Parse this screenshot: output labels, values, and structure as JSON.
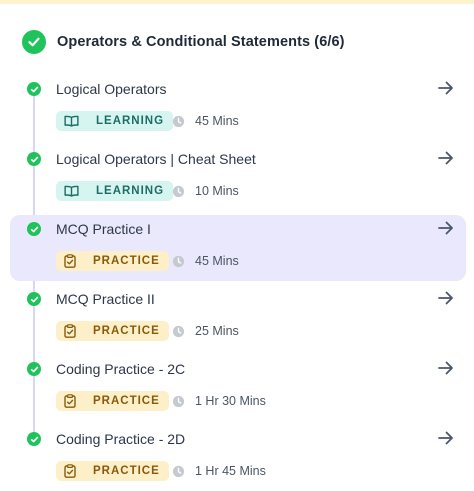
{
  "section": {
    "title": "Operators & Conditional Statements (6/6)"
  },
  "items": [
    {
      "title": "Logical Operators",
      "type": "LEARNING",
      "duration": "45 Mins",
      "active": false
    },
    {
      "title": "Logical Operators | Cheat Sheet",
      "type": "LEARNING",
      "duration": "10 Mins",
      "active": false
    },
    {
      "title": "MCQ Practice I",
      "type": "PRACTICE",
      "duration": "45 Mins",
      "active": true
    },
    {
      "title": "MCQ Practice II",
      "type": "PRACTICE",
      "duration": "25 Mins",
      "active": false
    },
    {
      "title": "Coding Practice - 2C",
      "type": "PRACTICE",
      "duration": "1 Hr 30 Mins",
      "active": false
    },
    {
      "title": "Coding Practice - 2D",
      "type": "PRACTICE",
      "duration": "1 Hr 45 Mins",
      "active": false
    }
  ],
  "icons": {
    "completed": "check-circle-icon",
    "open": "arrow-right-icon",
    "learning": "book-open-icon",
    "practice": "clipboard-check-icon",
    "duration": "clock-icon"
  },
  "colors": {
    "completed": "#20c35b",
    "active_row": "#e9e8fc",
    "learning_badge_bg": "#d6f5f1",
    "learning_badge_text": "#1e6c66",
    "practice_badge_bg": "#fdefc7",
    "practice_badge_text": "#8a5a0c"
  }
}
